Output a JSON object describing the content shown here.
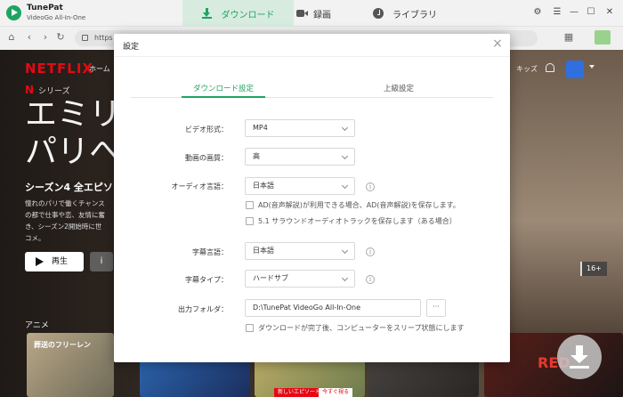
{
  "titlebar": {
    "app_name": "TunePat",
    "app_sub": "VideoGo All-In-One",
    "tabs": [
      {
        "label": "ダウンロード"
      },
      {
        "label": "録画"
      },
      {
        "label": "ライブラリ"
      }
    ]
  },
  "browser": {
    "url": "https"
  },
  "netflix": {
    "logo": "NETFLIX",
    "nav_home": "ホーム",
    "series_mark": "N",
    "series_label": "シリーズ",
    "title_line1": "エミリ",
    "title_line2": "パリへ",
    "season": "シーズン4 全エピソ",
    "desc_lines": [
      "憧れのパリで働くチャンス",
      "の都で仕事や恋、友情に奮",
      "き、シーズン2開始時に世",
      "コメ。"
    ],
    "play_label": "再生",
    "info_label": "i",
    "kids_label": "キッズ",
    "rating": "16+",
    "row_title": "アニメ",
    "thumbs": [
      "葬送のフリーレン",
      "",
      "",
      "",
      "RED"
    ],
    "badge_new": "新しいエピソード",
    "badge_watch": "今すぐ視る"
  },
  "dialog": {
    "title": "設定",
    "tabs": {
      "download": "ダウンロード設定",
      "advanced": "上級設定"
    },
    "video_format": {
      "label": "ビデオ形式：",
      "value": "MP4"
    },
    "video_quality": {
      "label": "動画の画質：",
      "value": "高"
    },
    "audio_lang": {
      "label": "オーディオ言語：",
      "value": "日本語"
    },
    "ad_option": "AD(音声解説)が利用できる場合、AD(音声解説)を保存します。",
    "surround_option": "5.1 サラウンドオーディオトラックを保存します（ある場合）",
    "subtitle_lang": {
      "label": "字幕言語：",
      "value": "日本語"
    },
    "subtitle_type": {
      "label": "字幕タイプ：",
      "value": "ハードサブ"
    },
    "output_folder": {
      "label": "出力フォルダ：",
      "value": "D:\\TunePat VideoGo All-In-One",
      "more": "···"
    },
    "sleep_option": "ダウンロードが完了後、コンピューターをスリープ状態にします",
    "info_icon": "i",
    "close_icon": "×"
  }
}
